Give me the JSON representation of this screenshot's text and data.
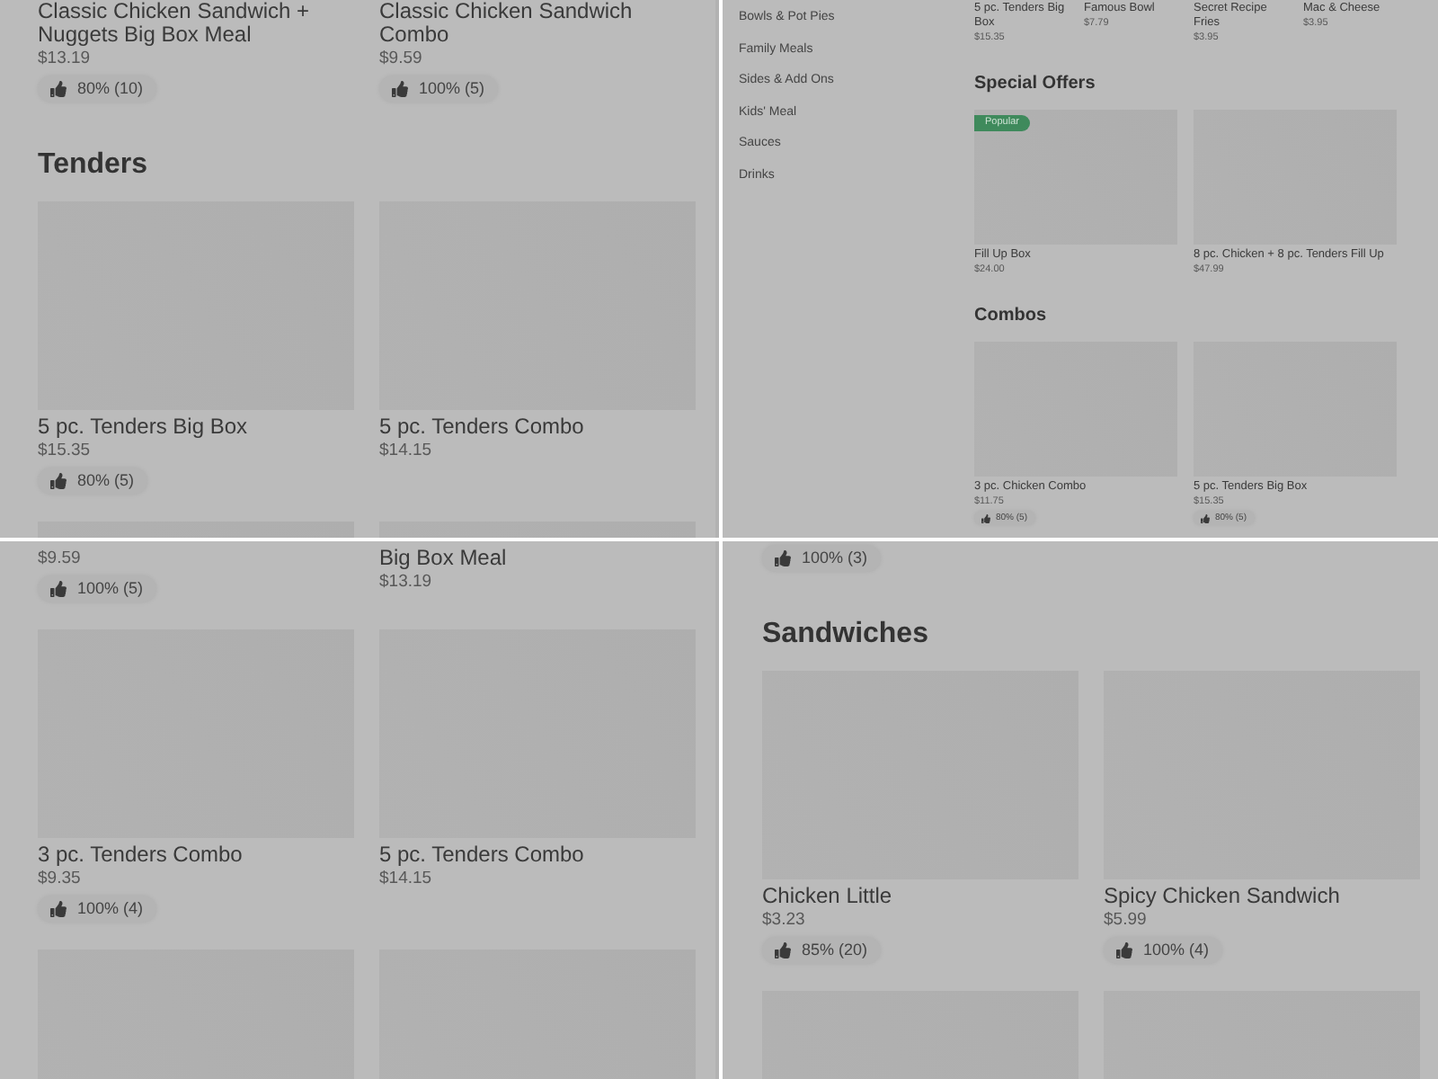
{
  "panels": [
    {
      "kind": "menu",
      "sections": [
        {
          "kind": "cards",
          "cards": [
            {
              "name": "Classic Chicken Sandwich + Nuggets Big Box Meal",
              "price": "$13.19",
              "rating": "80% (10)"
            },
            {
              "name": "Classic Chicken Sandwich Combo",
              "price": "$9.59",
              "rating": "100% (5)"
            }
          ]
        },
        {
          "kind": "heading",
          "title": "Tenders"
        },
        {
          "kind": "cards",
          "cards": [
            {
              "image": true,
              "name": "5 pc. Tenders Big Box",
              "price": "$15.35",
              "rating": "80% (5)"
            },
            {
              "image": true,
              "name": "5 pc. Tenders Combo",
              "price": "$14.15"
            }
          ]
        },
        {
          "kind": "cards",
          "cards": [
            {
              "image": true
            },
            {
              "image": true
            }
          ]
        }
      ]
    },
    {
      "kind": "store",
      "sidebar": {
        "items": [
          "Bowls & Pot Pies",
          "Family Meals",
          "Sides & Add Ons",
          "Kids' Meal",
          "Sauces",
          "Drinks"
        ]
      },
      "sections": [
        {
          "kind": "cards",
          "cards": [
            {
              "name": "5 pc. Tenders Big Box",
              "price": "$15.35"
            },
            {
              "name": "Famous Bowl",
              "price": "$7.79"
            },
            {
              "name": "Secret Recipe Fries",
              "price": "$3.95"
            },
            {
              "name": "Mac & Cheese",
              "price": "$3.95"
            }
          ]
        },
        {
          "kind": "heading",
          "title": "Special Offers"
        },
        {
          "kind": "cards",
          "cards": [
            {
              "image": true,
              "badge": "Popular",
              "name": "Fill Up Box",
              "price": "$24.00"
            },
            {
              "image": true,
              "name": "8 pc. Chicken + 8 pc. Tenders Fill Up",
              "price": "$47.99"
            }
          ]
        },
        {
          "kind": "heading",
          "title": "Combos"
        },
        {
          "kind": "cards",
          "cards": [
            {
              "image": true,
              "name": "3 pc. Chicken Combo",
              "price": "$11.75",
              "rating": "80% (5)"
            },
            {
              "image": true,
              "name": "5 pc. Tenders Big Box",
              "price": "$15.35",
              "rating": "80% (5)"
            }
          ]
        }
      ]
    },
    {
      "kind": "menu",
      "sections": [
        {
          "kind": "cards",
          "cards": [
            {
              "price": "$9.59",
              "rating": "100% (5)"
            },
            {
              "name": "Big Box Meal",
              "price": "$13.19"
            }
          ]
        },
        {
          "kind": "cards",
          "cards": [
            {
              "image": true,
              "name": "3 pc. Tenders Combo",
              "price": "$9.35",
              "rating": "100% (4)"
            },
            {
              "image": true,
              "name": "5 pc. Tenders Combo",
              "price": "$14.15"
            }
          ]
        },
        {
          "kind": "cards",
          "cards": [
            {
              "image": true
            },
            {
              "image": true
            }
          ]
        }
      ]
    },
    {
      "kind": "menu",
      "sections": [
        {
          "kind": "cards",
          "cards": [
            {
              "rating": "100% (3)"
            }
          ]
        },
        {
          "kind": "heading",
          "title": "Sandwiches"
        },
        {
          "kind": "cards",
          "cards": [
            {
              "image": true,
              "name": "Chicken Little",
              "price": "$3.23",
              "rating": "85% (20)"
            },
            {
              "image": true,
              "name": "Spicy Chicken Sandwich",
              "price": "$5.99",
              "rating": "100% (4)"
            }
          ]
        },
        {
          "kind": "cards",
          "cards": [
            {
              "image": true
            },
            {
              "image": true
            }
          ]
        }
      ]
    }
  ]
}
